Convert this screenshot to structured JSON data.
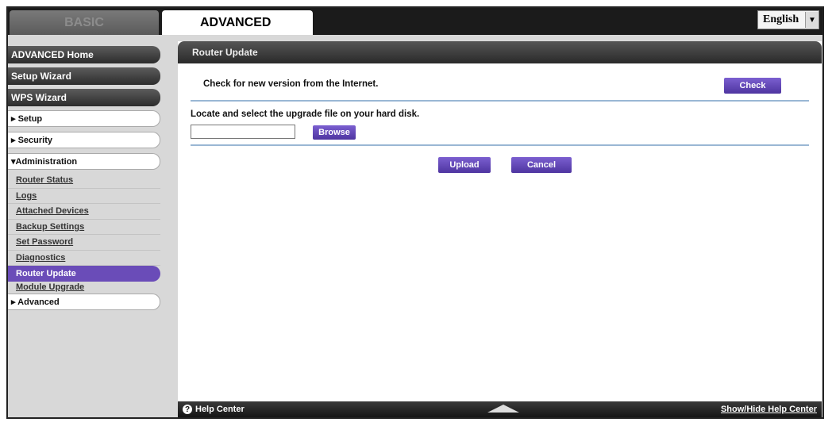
{
  "tabs": {
    "basic": "BASIC",
    "advanced": "ADVANCED"
  },
  "language": {
    "selected": "English",
    "arrow": "▼"
  },
  "sidebar": {
    "dark_items": [
      "ADVANCED Home",
      "Setup Wizard",
      "WPS Wizard"
    ],
    "setup": "▸ Setup",
    "security": "▸ Security",
    "administration": "▾Administration",
    "admin_sub": [
      "Router Status",
      "Logs",
      "Attached Devices",
      "Backup Settings",
      "Set Password",
      "Diagnostics",
      "Router Update",
      "Module Upgrade"
    ],
    "active_sub": "Router Update",
    "advanced": "▸ Advanced"
  },
  "main": {
    "title": "Router Update",
    "check_text": "Check for new version from the Internet.",
    "check_button": "Check",
    "locate_text": "Locate and select the upgrade file on your hard disk.",
    "file_value": "",
    "browse_button": "Browse",
    "upload_button": "Upload",
    "cancel_button": "Cancel"
  },
  "footer": {
    "help_icon": "?",
    "help_center": "Help Center",
    "show_hide": "Show/Hide Help Center"
  },
  "colors": {
    "accent": "#6a4cb8",
    "divider": "#9ab7d4",
    "header": "#2a2a2a"
  }
}
